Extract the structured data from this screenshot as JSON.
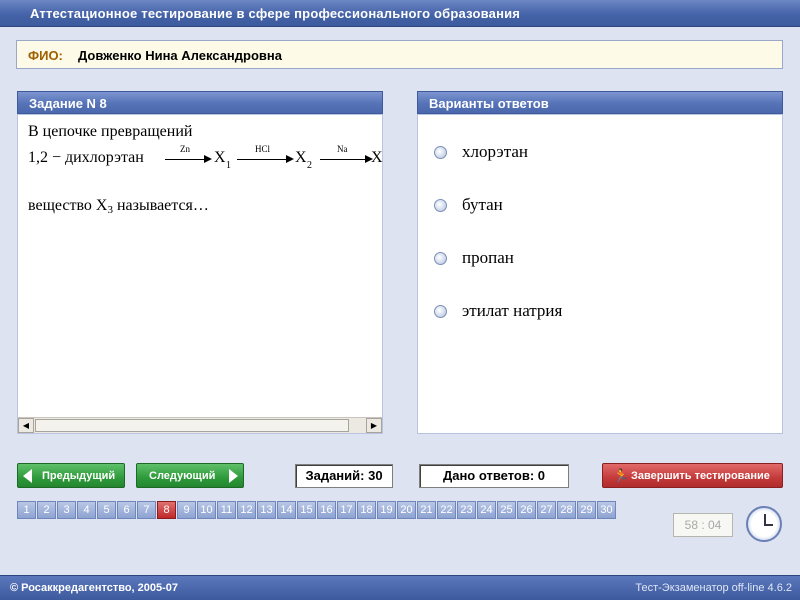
{
  "app": {
    "title": "Аттестационное тестирование в сфере профессионального образования"
  },
  "fio": {
    "label": "ФИО:",
    "name": "Довженко Нина Александровна"
  },
  "task": {
    "header": "Задание N 8",
    "line1": "В цепочке превращений",
    "chain": {
      "start": "1,2 − дихлорэтан",
      "reagent1": "Zn",
      "x1": "X",
      "x1_sub": "1",
      "reagent2": "HCl",
      "x2": "X",
      "x2_sub": "2",
      "reagent3": "Na",
      "x3": "X"
    },
    "question_prefix": "вещество X",
    "question_sub": "3",
    "question_suffix": " называется…",
    "scroll_left": "◀",
    "scroll_right": "▶"
  },
  "answers": {
    "header": "Варианты ответов",
    "options": [
      "хлорэтан",
      "бутан",
      "пропан",
      "этилат натрия"
    ]
  },
  "controls": {
    "prev_label": "Предыдущий",
    "next_label": "Следующий",
    "tasks_count": "Заданий: 30",
    "answered_count": "Дано ответов: 0",
    "finish_label": "Завершить тестирование",
    "finish_icon": "runner-icon"
  },
  "pages": {
    "items": [
      "1",
      "2",
      "3",
      "4",
      "5",
      "6",
      "7",
      "8",
      "9",
      "10",
      "11",
      "12",
      "13",
      "14",
      "15",
      "16",
      "17",
      "18",
      "19",
      "20",
      "21",
      "22",
      "23",
      "24",
      "25",
      "26",
      "27",
      "28",
      "29",
      "30"
    ],
    "current": "8"
  },
  "timer": {
    "value": "58 : 04"
  },
  "footer": {
    "copyright": "© Росаккредагентство, 2005-07",
    "version": "Тест-Экзаменатор off-line 4.6.2"
  },
  "colors": {
    "accent": "#4563a8",
    "nav_green": "#2e9a3a",
    "finish_red": "#c43a3a",
    "active_page": "#c02828"
  }
}
